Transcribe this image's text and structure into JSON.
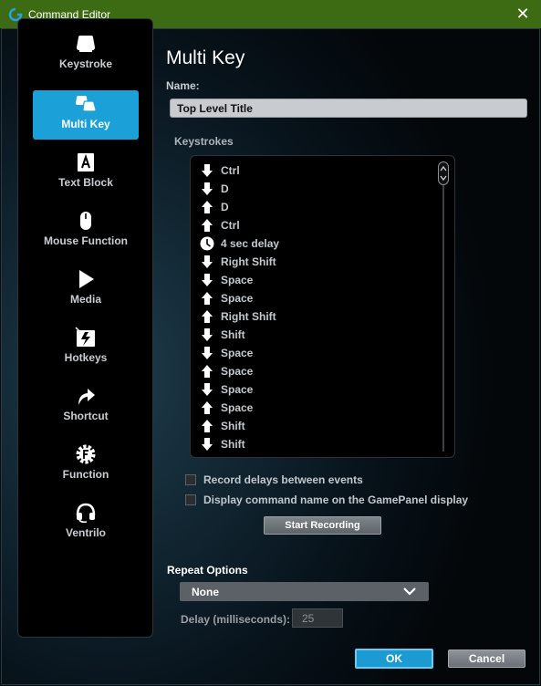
{
  "window": {
    "title": "Command Editor",
    "close_symbol": "✕"
  },
  "sidebar": {
    "items": [
      {
        "label": "Keystroke",
        "icon": "keycap-icon",
        "active": false
      },
      {
        "label": "Multi Key",
        "icon": "multi-keycap-icon",
        "active": true
      },
      {
        "label": "Text Block",
        "icon": "text-block-icon",
        "active": false
      },
      {
        "label": "Mouse Function",
        "icon": "mouse-icon",
        "active": false
      },
      {
        "label": "Media",
        "icon": "play-icon",
        "active": false
      },
      {
        "label": "Hotkeys",
        "icon": "hotkeys-icon",
        "active": false
      },
      {
        "label": "Shortcut",
        "icon": "shortcut-arrow-icon",
        "active": false
      },
      {
        "label": "Function",
        "icon": "function-gear-icon",
        "active": false
      },
      {
        "label": "Ventrilo",
        "icon": "headset-icon",
        "active": false
      }
    ]
  },
  "main": {
    "heading": "Multi Key",
    "name_label": "Name:",
    "name_value": "Top Level Title",
    "keystrokes_label": "Keystrokes",
    "keystrokes": [
      {
        "dir": "down",
        "text": "Ctrl"
      },
      {
        "dir": "down",
        "text": "D"
      },
      {
        "dir": "up",
        "text": "D"
      },
      {
        "dir": "up",
        "text": "Ctrl"
      },
      {
        "dir": "delay",
        "text": "4 sec delay"
      },
      {
        "dir": "down",
        "text": "Right Shift"
      },
      {
        "dir": "down",
        "text": "Space"
      },
      {
        "dir": "up",
        "text": "Space"
      },
      {
        "dir": "up",
        "text": "Right Shift"
      },
      {
        "dir": "down",
        "text": "Shift"
      },
      {
        "dir": "down",
        "text": "Space"
      },
      {
        "dir": "up",
        "text": "Space"
      },
      {
        "dir": "down",
        "text": "Space"
      },
      {
        "dir": "up",
        "text": "Space"
      },
      {
        "dir": "up",
        "text": "Shift"
      },
      {
        "dir": "down",
        "text": "Shift"
      }
    ],
    "record_delays_label": "Record delays between events",
    "display_name_label": "Display command name on the GamePanel display",
    "start_recording_label": "Start Recording",
    "repeat_options_label": "Repeat Options",
    "repeat_value": "None",
    "delay_label": "Delay (milliseconds):",
    "delay_value": "25",
    "ok_label": "OK",
    "cancel_label": "Cancel"
  },
  "colors": {
    "titlebar": "#3c6b13",
    "accent": "#1ba1d8",
    "ok_border": "#6cc9f0"
  }
}
